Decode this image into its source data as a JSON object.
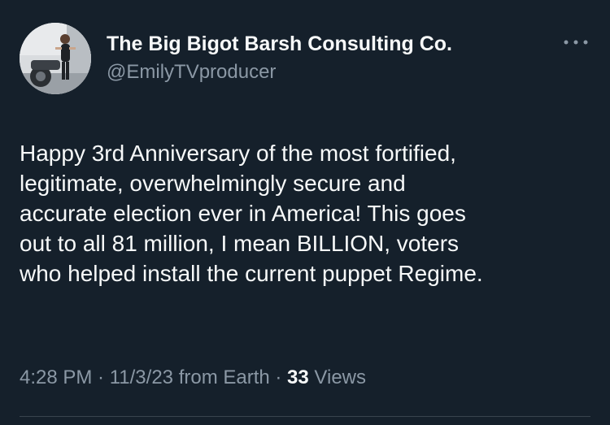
{
  "tweet": {
    "display_name": "The Big Bigot Barsh Consulting Co.",
    "handle": "@EmilyTVproducer",
    "text_lines": [
      "Happy 3rd Anniversary of the most fortified,",
      "legitimate, overwhelmingly secure and",
      "accurate election ever in America! This goes",
      "out to all 81 million, I mean BILLION, voters",
      "who helped install the current puppet Regime."
    ],
    "time": "4:28 PM",
    "date": "11/3/23",
    "source": "from Earth",
    "separator": " · ",
    "views_count": "33",
    "views_label": "Views"
  },
  "icons": {
    "more": "more-options-icon"
  },
  "colors": {
    "background": "#15202b",
    "primary_text": "#f7f9f9",
    "secondary_text": "#8b98a5",
    "divider": "#38444d"
  }
}
